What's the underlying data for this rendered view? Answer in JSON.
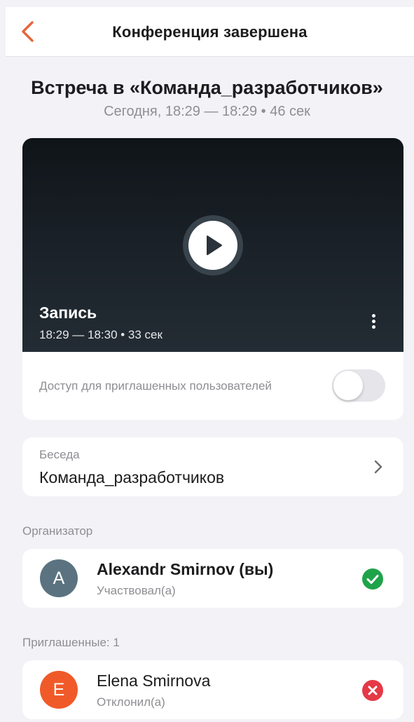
{
  "header": {
    "back_icon": "chevron-left-icon",
    "title": "Конференция завершена",
    "accent_color": "#e8643a"
  },
  "meeting": {
    "title": "Встреча в «Команда_разработчиков»",
    "subtitle": "Сегодня, 18:29 — 18:29 • 46 сек"
  },
  "recording": {
    "title": "Запись",
    "time": "18:29 — 18:30 • 33 сек",
    "play_icon": "play-icon",
    "menu_icon": "more-vertical-icon",
    "access_label": "Доступ для приглашенных пользователей",
    "access_enabled": false
  },
  "chat": {
    "label": "Беседа",
    "name": "Команда_разработчиков",
    "chevron_icon": "chevron-right-icon"
  },
  "organizer": {
    "section_label": "Организатор",
    "avatar_letter": "A",
    "avatar_color": "#5b7380",
    "name": "Alexandr Smirnov (вы)",
    "status": "Участвовал(а)",
    "status_icon": "check-circle-icon",
    "status_color": "#1fa34a"
  },
  "invited": {
    "section_label": "Приглашенные: 1",
    "people": [
      {
        "avatar_letter": "E",
        "avatar_color": "#f05a28",
        "name": "Elena Smirnova",
        "status": "Отклонил(а)",
        "status_icon": "close-circle-icon",
        "status_color": "#e53946"
      }
    ]
  }
}
